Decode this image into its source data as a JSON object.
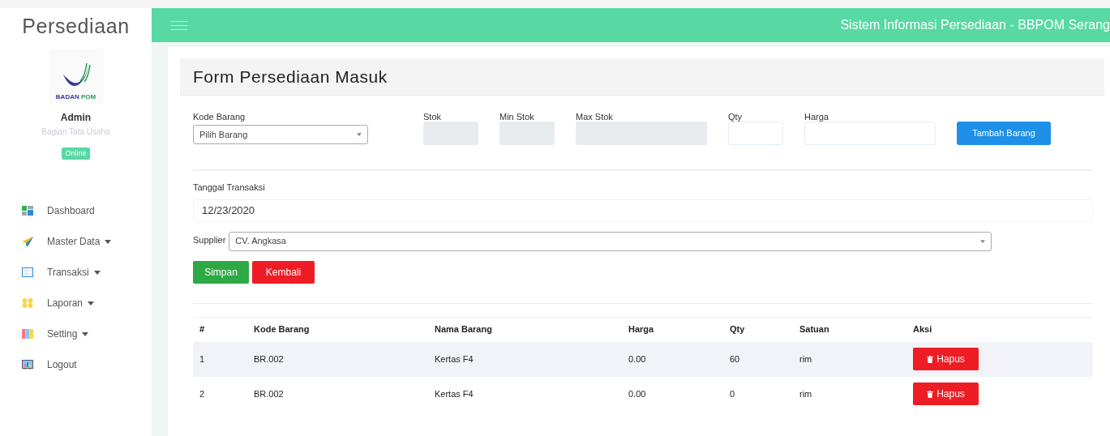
{
  "sidebar": {
    "brand": "Persediaan",
    "logo_text_1": "BADAN",
    "logo_text_2": "POM",
    "user": {
      "name": "Admin",
      "role": "Bagian Tata Usaha",
      "status": "Online"
    },
    "items": [
      {
        "label": "Dashboard",
        "kind": "dashboard",
        "has_caret": false
      },
      {
        "label": "Master Data",
        "kind": "plane",
        "has_caret": true
      },
      {
        "label": "Transaksi",
        "kind": "table",
        "has_caret": true
      },
      {
        "label": "Laporan",
        "kind": "dots",
        "has_caret": true
      },
      {
        "label": "Setting",
        "kind": "columns",
        "has_caret": true
      },
      {
        "label": "Logout",
        "kind": "chart",
        "has_caret": false
      }
    ]
  },
  "header": {
    "title": "Sistem Informasi Persediaan - BBPOM Serang"
  },
  "form": {
    "title": "Form Persediaan Masuk",
    "item_fields": [
      {
        "label": "Kode Barang",
        "kind": "select",
        "value": "Pilih Barang"
      },
      {
        "label": "Stok",
        "kind": "readonly"
      },
      {
        "label": "Min Stok",
        "kind": "readonly"
      },
      {
        "label": "Max Stok",
        "kind": "readonly"
      },
      {
        "label": "Qty",
        "kind": "input"
      },
      {
        "label": "Harga",
        "kind": "input"
      }
    ],
    "add_button": "Tambah Barang",
    "date_label": "Tanggal Transaksi",
    "date_value": "12/23/2020",
    "supplier_label": "Supplier",
    "supplier_value": "CV. Angkasa",
    "save_button": "Simpan",
    "back_button": "Kembali"
  },
  "table": {
    "columns": [
      "#",
      "Kode Barang",
      "Nama Barang",
      "Harga",
      "Qty",
      "Satuan",
      "Aksi"
    ],
    "rows": [
      {
        "cells": [
          "1",
          "BR.002",
          "Kertas F4",
          "0.00",
          "60",
          "rim"
        ],
        "action": "Hapus"
      },
      {
        "cells": [
          "2",
          "BR.002",
          "Kertas F4",
          "0.00",
          "0",
          "rim"
        ],
        "action": "Hapus"
      }
    ]
  }
}
